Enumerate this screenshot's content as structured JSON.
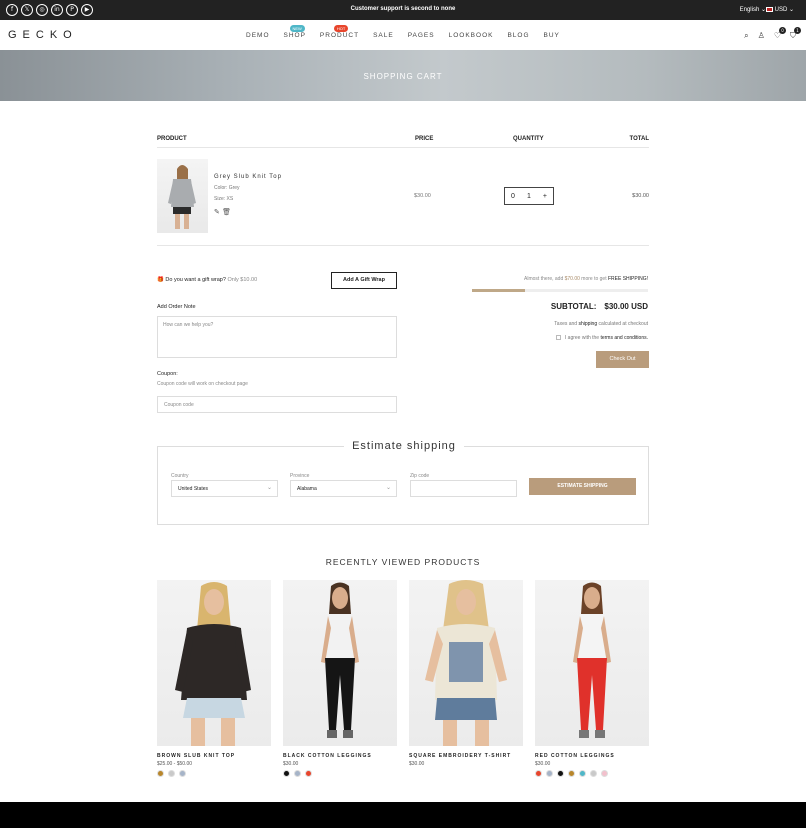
{
  "topbar": {
    "socials": [
      {
        "name": "facebook-icon",
        "glyph": "f"
      },
      {
        "name": "x-icon",
        "glyph": "𝕏"
      },
      {
        "name": "instagram-icon",
        "glyph": "◎"
      },
      {
        "name": "linkedin-icon",
        "glyph": "in"
      },
      {
        "name": "pinterest-icon",
        "glyph": "P"
      },
      {
        "name": "youtube-icon",
        "glyph": "▶"
      }
    ],
    "announcement": "Customer support is second to none",
    "language": "English",
    "currency": "USD"
  },
  "header": {
    "logo": "GECKO",
    "nav": [
      {
        "label": "DEMO"
      },
      {
        "label": "SHOP",
        "badge": "NEW",
        "badge_color": "#4fb7c8"
      },
      {
        "label": "PRODUCT",
        "badge": "HOT",
        "badge_color": "#e8452c"
      },
      {
        "label": "SALE"
      },
      {
        "label": "PAGES"
      },
      {
        "label": "LOOKBOOK"
      },
      {
        "label": "BLOG"
      },
      {
        "label": "BUY"
      }
    ],
    "wishlist_count": "0",
    "cart_count": "1"
  },
  "hero": {
    "title": "SHOPPING CART"
  },
  "cart": {
    "headers": {
      "product": "PRODUCT",
      "price": "PRICE",
      "quantity": "QUANTITY",
      "total": "TOTAL"
    },
    "item": {
      "name": "Grey Slub Knit Top",
      "color": "Color: Grey",
      "size": "Size: XS",
      "price": "$30.00",
      "quantity": "1",
      "minus": "0",
      "plus": "+",
      "total": "$30.00"
    },
    "gift_question": "Do you want a gift wrap?",
    "gift_price": "Only $10.00",
    "gift_button": "Add A Gift Wrap",
    "order_note_label": "Add Order Note",
    "order_note_placeholder": "How can we help you?",
    "coupon_label": "Coupon:",
    "coupon_note": "Coupon code will work on checkout page",
    "coupon_placeholder": "Coupon code",
    "shipping_msg_pre": "Almost there, add ",
    "shipping_msg_amount": "$70.00",
    "shipping_msg_mid": " more to get ",
    "shipping_msg_free": "FREE SHIPPING!",
    "shipping_progress": 0.3,
    "subtotal_label": "SUBTOTAL:",
    "subtotal_value": "$30.00 USD",
    "taxes_pre": "Taxes and ",
    "taxes_shipping": "shipping",
    "taxes_post": " calculated at checkout",
    "agree_pre": "I agree with the ",
    "agree_terms": "terms and conditions.",
    "checkout_button": "Check Out"
  },
  "estimate": {
    "title": "Estimate shipping",
    "country_label": "Country",
    "country_value": "United States",
    "province_label": "Province",
    "province_value": "Alabama",
    "zip_label": "Zip code",
    "zip_value": "",
    "button": "ESTIMATE SHIPPING"
  },
  "recently_viewed": {
    "title": "RECENTLY VIEWED PRODUCTS",
    "products": [
      {
        "name": "BROWN SLUB KNIT TOP",
        "price": "$25.00 - $50.00",
        "swatches": [
          "#b8862b",
          "#c9c9c9",
          "#a6b4c8"
        ]
      },
      {
        "name": "BLACK COTTON LEGGINGS",
        "price": "$30.00",
        "swatches": [
          "#111111",
          "#a6b4c8",
          "#e8452c"
        ]
      },
      {
        "name": "SQUARE EMBROIDERY T-SHIRT",
        "price": "$30.00",
        "swatches": []
      },
      {
        "name": "RED COTTON LEGGINGS",
        "price": "$30.00",
        "swatches": [
          "#e8452c",
          "#a6b4c8",
          "#111111",
          "#b8862b",
          "#4fb7c8",
          "#c9c9c9",
          "#f2c0cc"
        ]
      }
    ]
  }
}
